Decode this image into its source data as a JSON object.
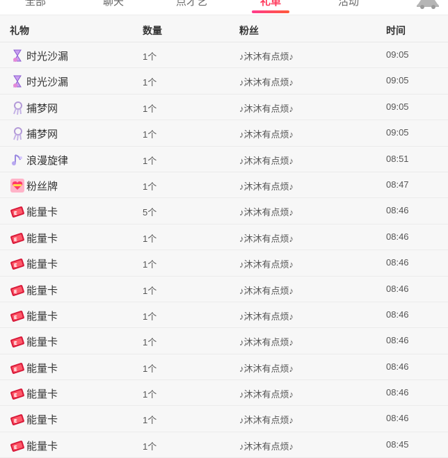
{
  "tabs": [
    {
      "label": "全部",
      "active": false
    },
    {
      "label": "聊天",
      "active": false
    },
    {
      "label": "点才艺",
      "active": false
    },
    {
      "label": "礼单",
      "active": true
    },
    {
      "label": "活动",
      "active": false
    }
  ],
  "colors": {
    "accent": "#ff3a5c",
    "row_bg": "#f7f7f7",
    "divider": "#ebebeb"
  },
  "table": {
    "headers": {
      "gift": "礼物",
      "quantity": "数量",
      "fan": "粉丝",
      "time": "时间"
    },
    "rows": [
      {
        "icon": "hourglass-gift-icon",
        "gift": "时光沙漏",
        "quantity": "1个",
        "fan": "♪沐沐有点烦♪",
        "time": "09:05"
      },
      {
        "icon": "hourglass-gift-icon",
        "gift": "时光沙漏",
        "quantity": "1个",
        "fan": "♪沐沐有点烦♪",
        "time": "09:05"
      },
      {
        "icon": "dreamcatcher-gift-icon",
        "gift": "捕梦网",
        "quantity": "1个",
        "fan": "♪沐沐有点烦♪",
        "time": "09:05"
      },
      {
        "icon": "dreamcatcher-gift-icon",
        "gift": "捕梦网",
        "quantity": "1个",
        "fan": "♪沐沐有点烦♪",
        "time": "09:05"
      },
      {
        "icon": "melody-gift-icon",
        "gift": "浪漫旋律",
        "quantity": "1个",
        "fan": "♪沐沐有点烦♪",
        "time": "08:51"
      },
      {
        "icon": "fan-badge-gift-icon",
        "gift": "粉丝牌",
        "quantity": "1个",
        "fan": "♪沐沐有点烦♪",
        "time": "08:47"
      },
      {
        "icon": "energy-card-gift-icon",
        "gift": "能量卡",
        "quantity": "5个",
        "fan": "♪沐沐有点烦♪",
        "time": "08:46"
      },
      {
        "icon": "energy-card-gift-icon",
        "gift": "能量卡",
        "quantity": "1个",
        "fan": "♪沐沐有点烦♪",
        "time": "08:46"
      },
      {
        "icon": "energy-card-gift-icon",
        "gift": "能量卡",
        "quantity": "1个",
        "fan": "♪沐沐有点烦♪",
        "time": "08:46"
      },
      {
        "icon": "energy-card-gift-icon",
        "gift": "能量卡",
        "quantity": "1个",
        "fan": "♪沐沐有点烦♪",
        "time": "08:46"
      },
      {
        "icon": "energy-card-gift-icon",
        "gift": "能量卡",
        "quantity": "1个",
        "fan": "♪沐沐有点烦♪",
        "time": "08:46"
      },
      {
        "icon": "energy-card-gift-icon",
        "gift": "能量卡",
        "quantity": "1个",
        "fan": "♪沐沐有点烦♪",
        "time": "08:46"
      },
      {
        "icon": "energy-card-gift-icon",
        "gift": "能量卡",
        "quantity": "1个",
        "fan": "♪沐沐有点烦♪",
        "time": "08:46"
      },
      {
        "icon": "energy-card-gift-icon",
        "gift": "能量卡",
        "quantity": "1个",
        "fan": "♪沐沐有点烦♪",
        "time": "08:46"
      },
      {
        "icon": "energy-card-gift-icon",
        "gift": "能量卡",
        "quantity": "1个",
        "fan": "♪沐沐有点烦♪",
        "time": "08:46"
      },
      {
        "icon": "energy-card-gift-icon",
        "gift": "能量卡",
        "quantity": "1个",
        "fan": "♪沐沐有点烦♪",
        "time": "08:45"
      }
    ]
  }
}
